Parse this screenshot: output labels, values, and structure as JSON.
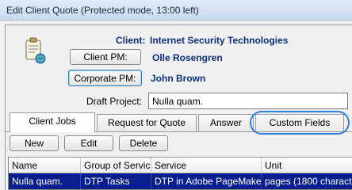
{
  "window": {
    "title": "Edit Client Quote (Protected mode, 13:00 left)"
  },
  "fields": {
    "client_label": "Client:",
    "client_value": "Internet Security Technologies",
    "client_pm_button": "Client PM:",
    "client_pm_value": "Olle Rosengren",
    "corporate_pm_button": "Corporate PM:",
    "corporate_pm_value": "John Brown",
    "draft_project_label": "Draft Project:",
    "draft_project_value": "Nulla quam."
  },
  "tabs": [
    {
      "label": "Client Jobs"
    },
    {
      "label": "Request for Quote"
    },
    {
      "label": "Answer"
    },
    {
      "label": "Custom Fields"
    }
  ],
  "toolbar": {
    "new_label": "New",
    "edit_label": "Edit",
    "delete_label": "Delete"
  },
  "grid": {
    "columns": [
      "Name",
      "Group of Servic",
      "Service",
      "Unit"
    ],
    "rows": [
      {
        "name": "Nulla quam.",
        "group": "DTP Tasks",
        "service": "DTP in Adobe PageMake",
        "unit": "pages (1800 characte"
      }
    ]
  },
  "colors": {
    "accent_text": "#0b2f7a",
    "selection": "#0a1f8f",
    "highlight_ring": "#2f7fe0"
  }
}
